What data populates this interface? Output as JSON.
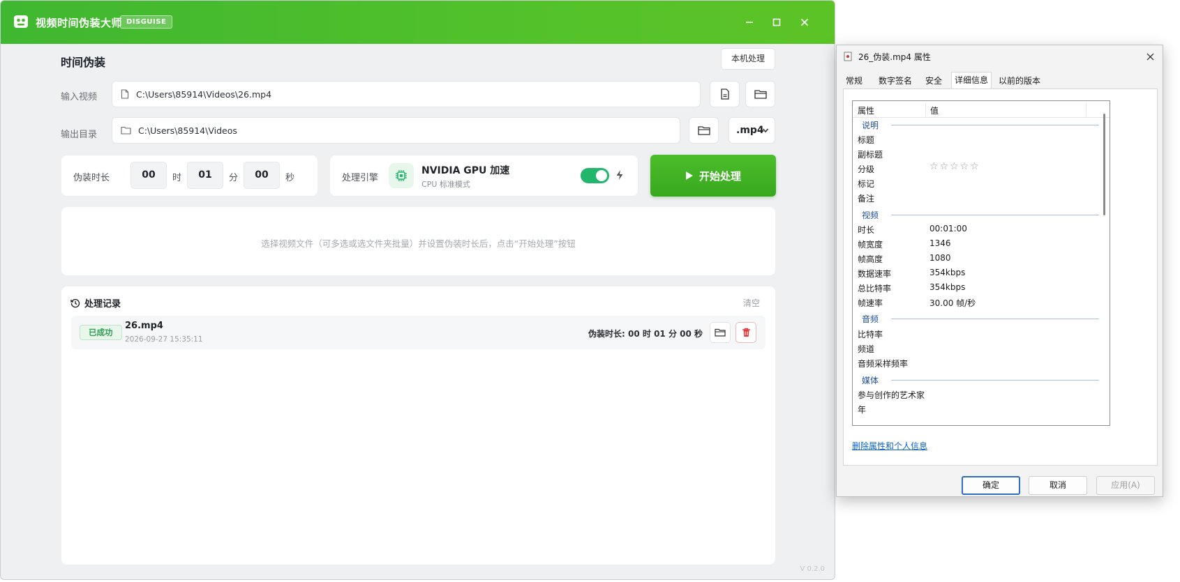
{
  "app": {
    "title": "视频时间伪装大师",
    "badge": "DISGUISE",
    "version": "V 0.2.0"
  },
  "main": {
    "section_title": "时间伪装",
    "local_button": "本机处理",
    "input": {
      "label": "输入视频",
      "value": "C:\\Users\\85914\\Videos\\26.mp4"
    },
    "output": {
      "label": "输出目录",
      "value": "C:\\Users\\85914\\Videos",
      "format": ".mp4"
    },
    "duration": {
      "label": "伪装时长",
      "hours": "00",
      "hours_unit": "时",
      "minutes": "01",
      "minutes_unit": "分",
      "seconds": "00",
      "seconds_unit": "秒"
    },
    "engine": {
      "label": "处理引擎",
      "name": "NVIDIA GPU 加速",
      "mode": "CPU 标准模式",
      "enabled": true
    },
    "start_button": "开始处理",
    "hint": "选择视频文件（可多选或选文件夹批量）并设置伪装时长后，点击“开始处理”按钮",
    "history": {
      "title": "处理记录",
      "clear": "清空",
      "records": [
        {
          "status": "已成功",
          "name": "26.mp4",
          "time": "2026-09-27 15:35:11",
          "duration": "伪装时长: 00 时 01 分 00 秒"
        }
      ]
    }
  },
  "dialog": {
    "title": "26_伪装.mp4 属性",
    "tabs": [
      "常规",
      "数字签名",
      "安全",
      "详细信息",
      "以前的版本"
    ],
    "active_tab": "详细信息",
    "columns": {
      "property": "属性",
      "value": "值"
    },
    "groups": {
      "description": "说明",
      "video": "视频",
      "audio": "音频",
      "media": "媒体"
    },
    "description_rows": {
      "title": "标题",
      "subtitle": "副标题",
      "rating": "分级",
      "rating_stars": "☆☆☆☆☆",
      "tags": "标记",
      "comments": "备注"
    },
    "video_rows": [
      {
        "name": "时长",
        "value": "00:01:00"
      },
      {
        "name": "帧宽度",
        "value": "1346"
      },
      {
        "name": "帧高度",
        "value": "1080"
      },
      {
        "name": "数据速率",
        "value": "354kbps"
      },
      {
        "name": "总比特率",
        "value": "354kbps"
      },
      {
        "name": "帧速率",
        "value": "30.00 帧/秒"
      }
    ],
    "audio_rows": [
      "比特率",
      "频道",
      "音频采样频率"
    ],
    "media_rows": [
      "参与创作的艺术家",
      "年"
    ],
    "remove_link": "删除属性和个人信息",
    "buttons": {
      "ok": "确定",
      "cancel": "取消",
      "apply": "应用(A)"
    }
  },
  "colors": {
    "brand_green": "#4cbd2a",
    "toggle_on": "#22b66b",
    "success": "#2e9e4f",
    "danger": "#e03b3b",
    "link": "#0b62c4"
  },
  "icons": [
    "app-logo-icon",
    "minimize-icon",
    "maximize-icon",
    "close-icon",
    "file-icon",
    "folder-icon",
    "chevron-down-icon",
    "chip-icon",
    "bolt-icon",
    "play-icon",
    "history-icon",
    "trash-icon"
  ]
}
